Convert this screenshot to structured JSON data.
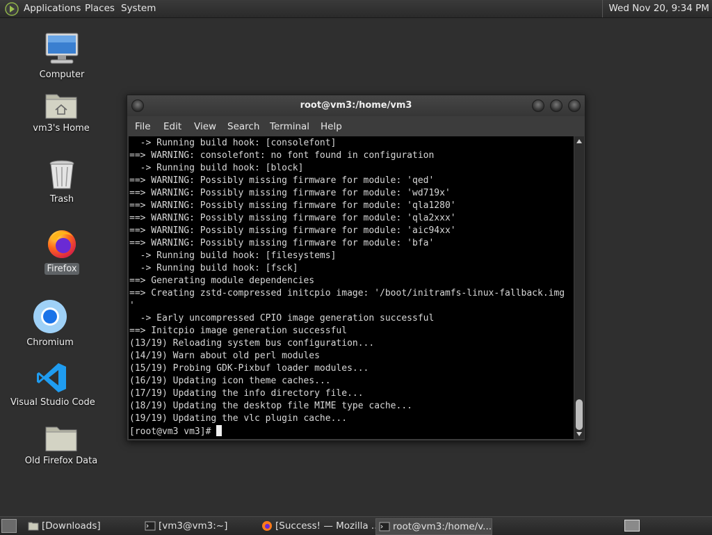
{
  "top_panel": {
    "menus": [
      "Applications",
      "Places",
      "System"
    ],
    "clock": "Wed Nov 20,  9:34 PM"
  },
  "desktop_icons": [
    {
      "label": "Computer",
      "icon": "computer-icon"
    },
    {
      "label": "vm3's Home",
      "icon": "home-folder-icon"
    },
    {
      "label": "Trash",
      "icon": "trash-icon"
    },
    {
      "label": "Firefox",
      "icon": "firefox-icon",
      "selected": true
    },
    {
      "label": "Chromium",
      "icon": "chromium-icon"
    },
    {
      "label": "Visual Studio Code",
      "icon": "vscode-icon"
    },
    {
      "label": "Old Firefox Data",
      "icon": "folder-icon"
    }
  ],
  "terminal": {
    "title": "root@vm3:/home/vm3",
    "menu": [
      "File",
      "Edit",
      "View",
      "Search",
      "Terminal",
      "Help"
    ],
    "lines": [
      "  -> Running build hook: [consolefont]",
      "==> WARNING: consolefont: no font found in configuration",
      "  -> Running build hook: [block]",
      "==> WARNING: Possibly missing firmware for module: 'qed'",
      "==> WARNING: Possibly missing firmware for module: 'wd719x'",
      "==> WARNING: Possibly missing firmware for module: 'qla1280'",
      "==> WARNING: Possibly missing firmware for module: 'qla2xxx'",
      "==> WARNING: Possibly missing firmware for module: 'aic94xx'",
      "==> WARNING: Possibly missing firmware for module: 'bfa'",
      "  -> Running build hook: [filesystems]",
      "  -> Running build hook: [fsck]",
      "==> Generating module dependencies",
      "==> Creating zstd-compressed initcpio image: '/boot/initramfs-linux-fallback.img",
      "'",
      "  -> Early uncompressed CPIO image generation successful",
      "==> Initcpio image generation successful",
      "(13/19) Reloading system bus configuration...",
      "(14/19) Warn about old perl modules",
      "(15/19) Probing GDK-Pixbuf loader modules...",
      "(16/19) Updating icon theme caches...",
      "(17/19) Updating the info directory file...",
      "(18/19) Updating the desktop file MIME type cache...",
      "(19/19) Updating the vlc plugin cache..."
    ],
    "prompt": "[root@vm3 vm3]# "
  },
  "taskbar": {
    "tasks": [
      {
        "label": "[Downloads]",
        "icon": "folder-icon",
        "active": false
      },
      {
        "label": "[vm3@vm3:~]",
        "icon": "terminal-icon",
        "active": false
      },
      {
        "label": "[Success! — Mozilla ...",
        "icon": "firefox-icon",
        "active": false
      },
      {
        "label": "root@vm3:/home/v...",
        "icon": "terminal-icon",
        "active": true
      }
    ]
  }
}
